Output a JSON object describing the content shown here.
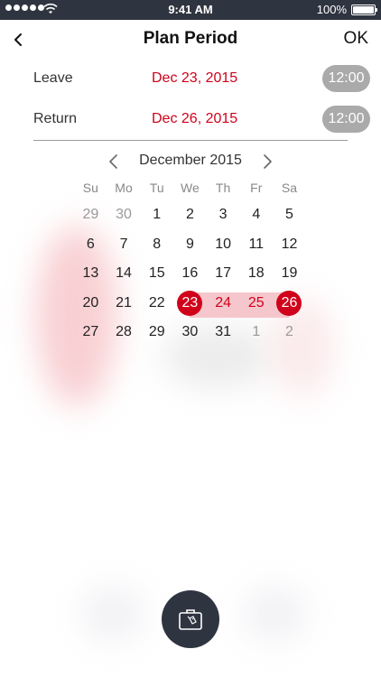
{
  "status_bar": {
    "time": "9:41 AM",
    "battery": "100%"
  },
  "nav": {
    "title": "Plan Period",
    "ok_label": "OK"
  },
  "leave": {
    "label": "Leave",
    "date": "Dec 23, 2015",
    "time": "12:00"
  },
  "return": {
    "label": "Return",
    "date": "Dec 26, 2015",
    "time": "12:00"
  },
  "calendar": {
    "month": "December 2015",
    "weekdays": [
      "Su",
      "Mo",
      "Tu",
      "We",
      "Th",
      "Fr",
      "Sa"
    ],
    "weeks": [
      [
        "29",
        "30",
        "1",
        "2",
        "3",
        "4",
        "5"
      ],
      [
        "6",
        "7",
        "8",
        "9",
        "10",
        "11",
        "12"
      ],
      [
        "13",
        "14",
        "15",
        "16",
        "17",
        "18",
        "19"
      ],
      [
        "20",
        "21",
        "22",
        "23",
        "24",
        "25",
        "26"
      ],
      [
        "27",
        "28",
        "29",
        "30",
        "31",
        "1",
        "2"
      ]
    ]
  },
  "colors": {
    "accent": "#d0021b",
    "dark": "#2f3540",
    "range": "#f5c7cc",
    "pill": "#aaaaaa"
  },
  "icons": {
    "back": "chevron-left-icon",
    "prev": "chevron-left-icon",
    "next": "chevron-right-icon",
    "luggage": "luggage-icon"
  }
}
